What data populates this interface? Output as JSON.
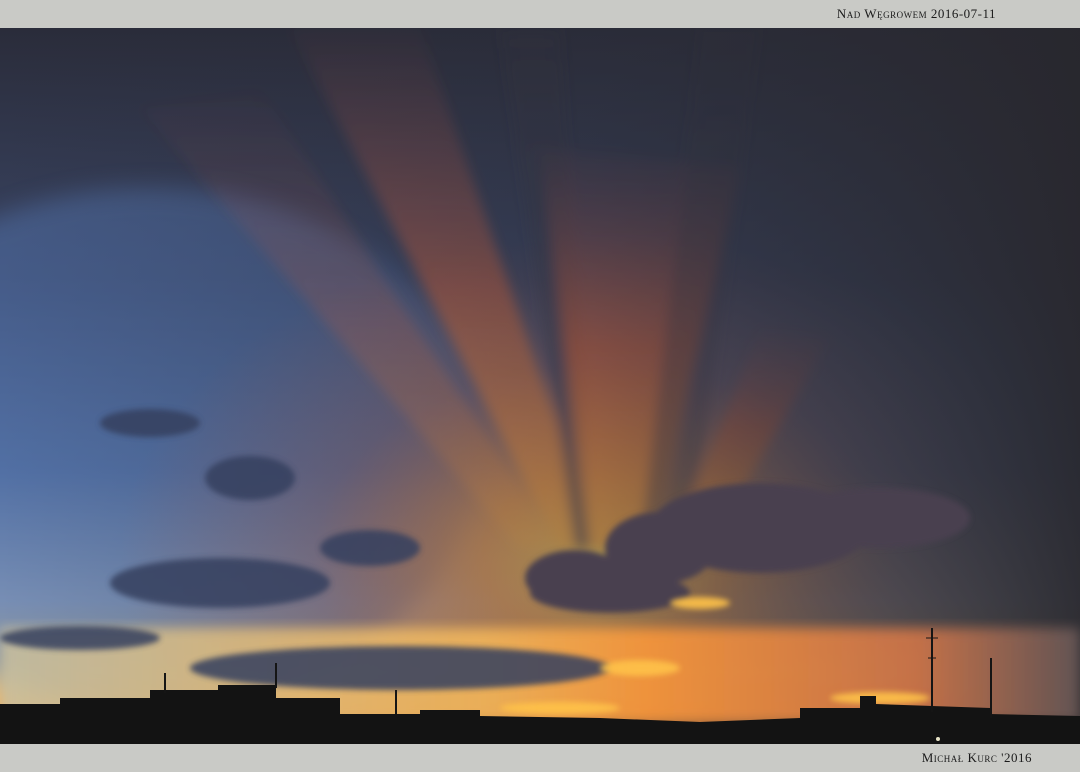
{
  "top_caption": "Nad Węgrowem 2016-07-11",
  "bottom_caption": "Michał Kurc '2016",
  "colors": {
    "frame": "#c9cac6",
    "sky_dark": "#2b2d3a",
    "sky_blue": "#5a78a8",
    "glow_orange": "#f08a3a",
    "glow_yellow": "#ffd35a",
    "silhouette": "#121212"
  },
  "photo": {
    "subject": "sunset crepuscular rays over town skyline"
  }
}
